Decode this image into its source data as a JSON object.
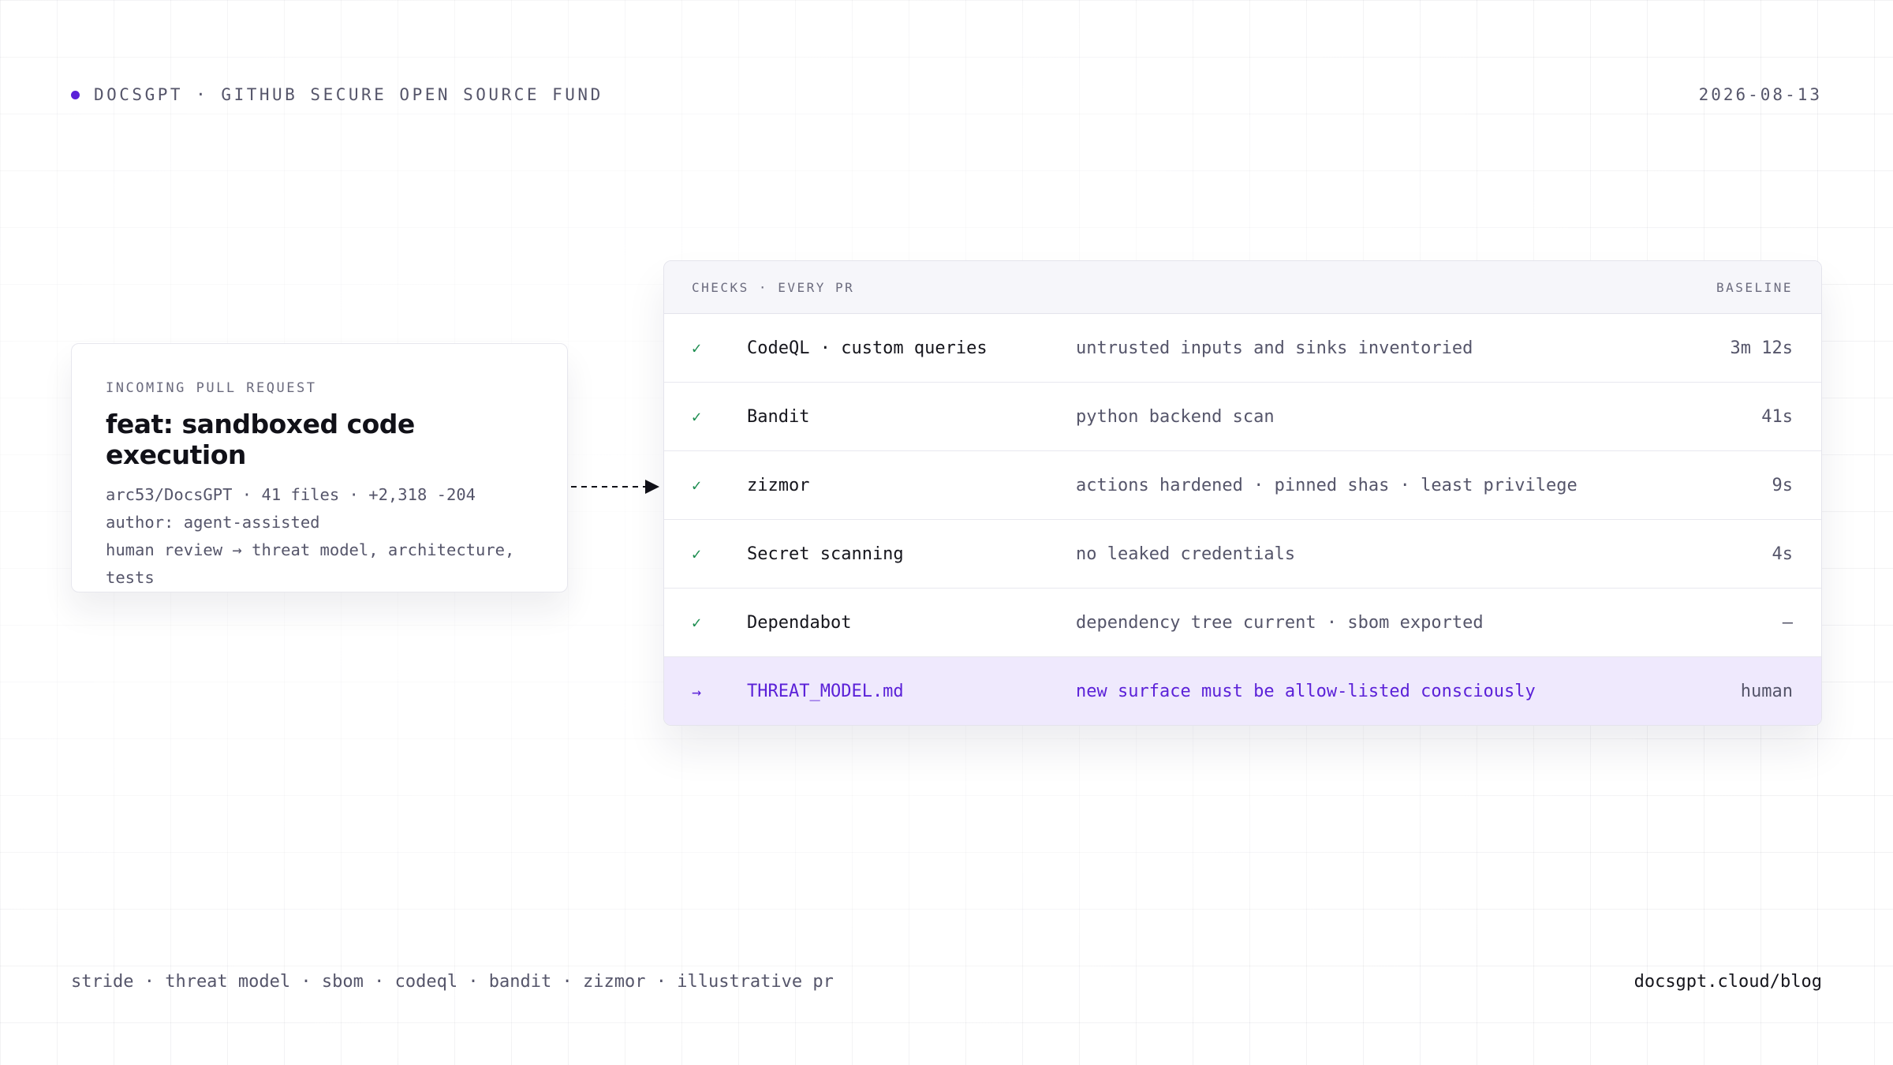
{
  "header": {
    "brand": "DOCSGPT · GITHUB SECURE OPEN SOURCE FUND",
    "date": "2026-08-13",
    "accent_color": "#5b21d8"
  },
  "pull_request": {
    "kicker": "INCOMING PULL REQUEST",
    "title": "feat: sandboxed code execution",
    "meta": [
      "arc53/DocsGPT · 41 files · +2,318 -204",
      "author: agent-assisted",
      "human review → threat model, architecture,",
      "tests"
    ]
  },
  "checks": {
    "header_left": "CHECKS · EVERY PR",
    "header_right": "BASELINE",
    "rows": [
      {
        "icon": "check-icon",
        "glyph": "✓",
        "name": "CodeQL · custom queries",
        "desc": "untrusted inputs and sinks inventoried",
        "time": "3m 12s"
      },
      {
        "icon": "check-icon",
        "glyph": "✓",
        "name": "Bandit",
        "desc": "python backend scan",
        "time": "41s"
      },
      {
        "icon": "check-icon",
        "glyph": "✓",
        "name": "zizmor",
        "desc": "actions hardened · pinned shas · least privilege",
        "time": "9s"
      },
      {
        "icon": "check-icon",
        "glyph": "✓",
        "name": "Secret scanning",
        "desc": "no leaked credentials",
        "time": "4s"
      },
      {
        "icon": "check-icon",
        "glyph": "✓",
        "name": "Dependabot",
        "desc": "dependency tree current · sbom exported",
        "time": "—"
      },
      {
        "icon": "arrow-right-icon",
        "glyph": "→",
        "name": "THREAT_MODEL.md",
        "desc": "new surface must be allow-listed consciously",
        "time": "human"
      }
    ],
    "pass_color": "#1a8c4e",
    "highlight_color": "#5b21d8"
  },
  "footer": {
    "tags": "stride · threat model · sbom · codeql · bandit · zizmor · illustrative pr",
    "link": "docsgpt.cloud/blog"
  }
}
